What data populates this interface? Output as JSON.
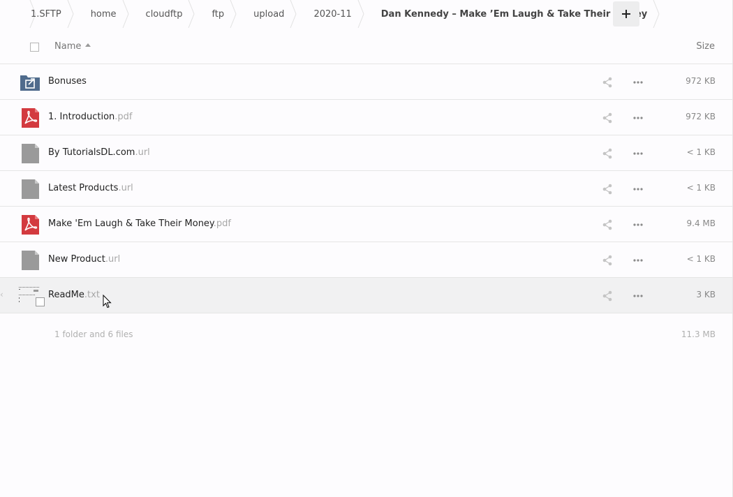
{
  "breadcrumb": {
    "items": [
      "1.SFTP",
      "home",
      "cloudftp",
      "ftp",
      "upload",
      "2020-11"
    ],
    "current": "Dan Kennedy – Make ’Em Laugh & Take Their Money",
    "add_label": "+"
  },
  "header": {
    "name": "Name",
    "size": "Size"
  },
  "files": [
    {
      "name": "Bonuses",
      "ext": "",
      "size": "972 KB",
      "icon": "shared-folder-icon"
    },
    {
      "name": "1. Introduction",
      "ext": ".pdf",
      "size": "972 KB",
      "icon": "pdf-icon"
    },
    {
      "name": "By TutorialsDL.com",
      "ext": ".url",
      "size": "< 1 KB",
      "icon": "generic-file-icon"
    },
    {
      "name": "Latest Products",
      "ext": ".url",
      "size": "< 1 KB",
      "icon": "generic-file-icon"
    },
    {
      "name": "Make 'Em Laugh & Take Their Money",
      "ext": ".pdf",
      "size": "9.4 MB",
      "icon": "pdf-icon"
    },
    {
      "name": "New Product",
      "ext": ".url",
      "size": "< 1 KB",
      "icon": "generic-file-icon"
    },
    {
      "name": "ReadMe",
      "ext": ".txt",
      "size": "3 KB",
      "icon": "text-file-icon"
    }
  ],
  "summary": {
    "count": "1 folder and 6 files",
    "total": "11.3 MB"
  },
  "colors": {
    "folder": "#4f6b8c",
    "pdf": "#d33a3f",
    "generic": "#9a9a9a",
    "row_highlight": "#f1f1f2"
  }
}
